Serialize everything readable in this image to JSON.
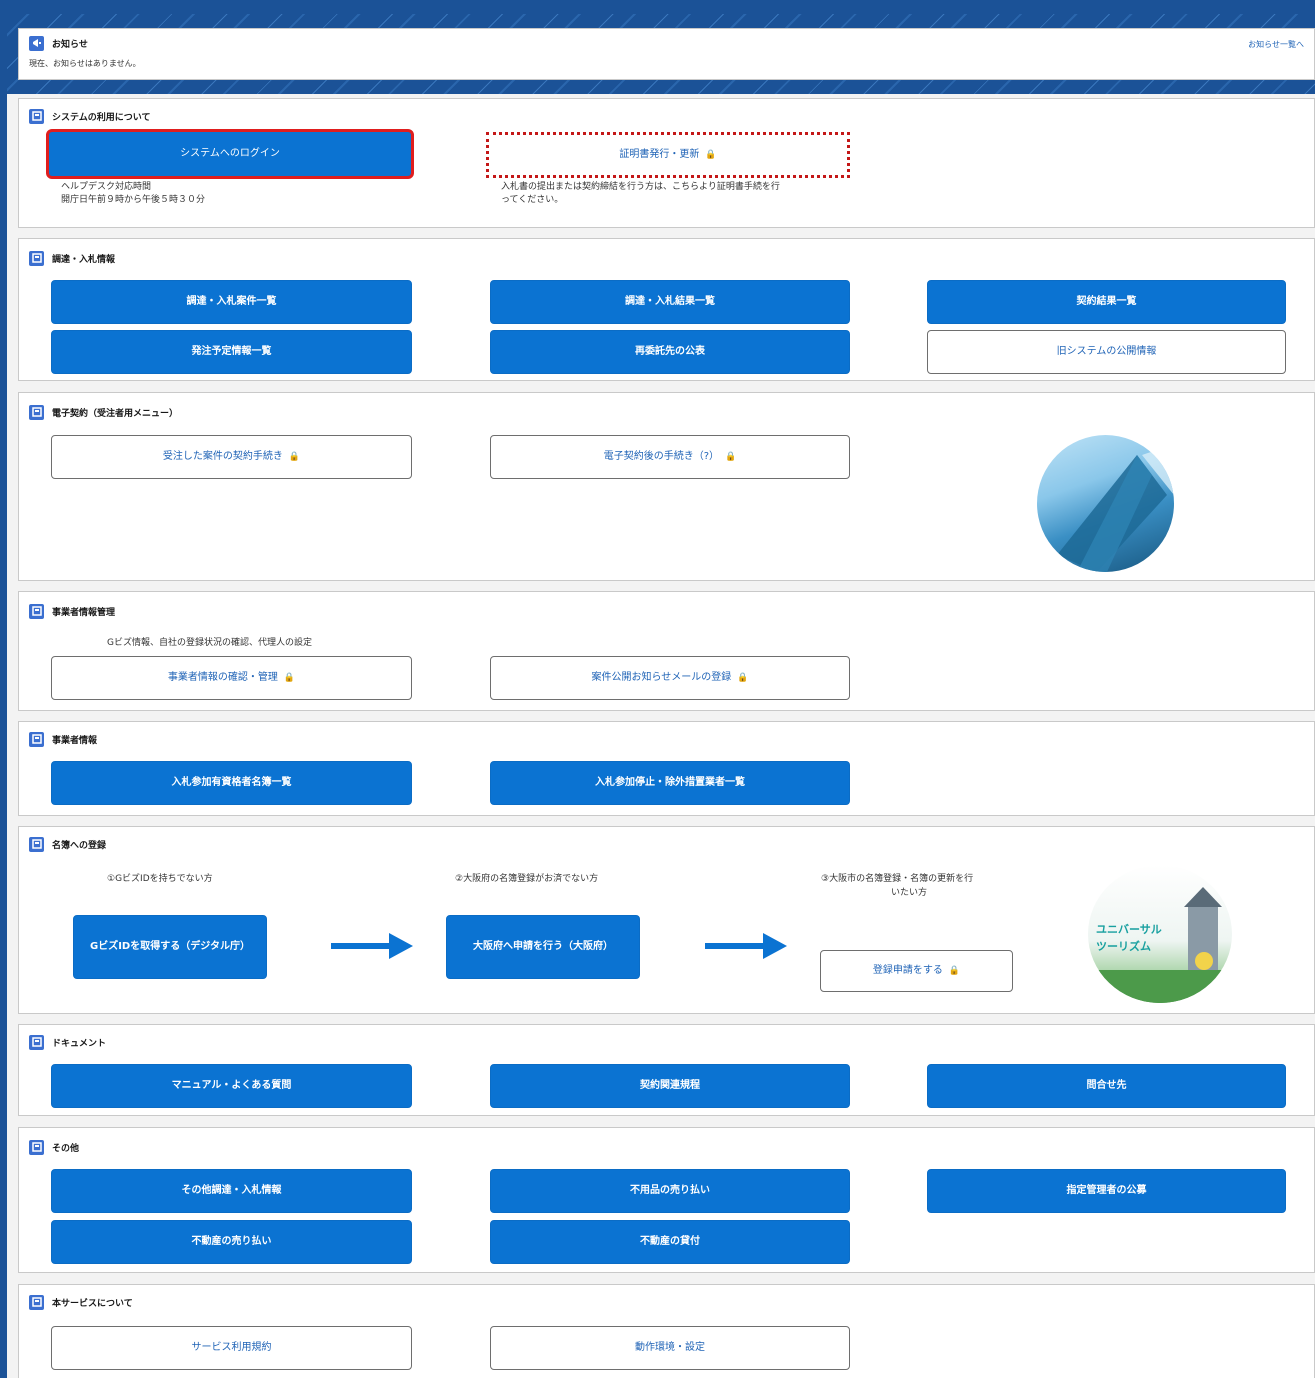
{
  "notice": {
    "title": "お知らせ",
    "message": "現在、お知らせはありません。",
    "list_link": "お知らせ一覧へ"
  },
  "system": {
    "title": "システムの利用について",
    "login_button": "システムへのログイン",
    "cert_button": "証明書発行・更新",
    "helpdesk_title": "ヘルプデスク対応時間",
    "helpdesk_hours": "開庁日午前９時から午後５時３０分",
    "cert_note_1": "入札書の提出または契約締結を行う方は、こちらより証明書手続を行",
    "cert_note_2": "ってください。"
  },
  "procurement": {
    "title": "調達・入札情報",
    "buttons": [
      "調達・入札案件一覧",
      "調達・入札結果一覧",
      "契約結果一覧",
      "発注予定情報一覧",
      "再委託先の公表",
      "旧システムの公開情報"
    ]
  },
  "econtract": {
    "title": "電子契約（受注者用メニュー）",
    "buttons": [
      "受注した案件の契約手続き",
      "電子契約後の手続き（?）"
    ]
  },
  "business_mgmt": {
    "title": "事業者情報管理",
    "description": "Gビズ情報、自社の登録状況の確認、代理人の設定",
    "buttons": [
      "事業者情報の確認・管理",
      "案件公開お知らせメールの登録"
    ]
  },
  "business_info": {
    "title": "事業者情報",
    "buttons": [
      "入札参加有資格者名簿一覧",
      "入札参加停止・除外措置業者一覧"
    ]
  },
  "registry": {
    "title": "名簿への登録",
    "step1_label": "①GビズIDを持ちでない方",
    "step1_button": "GビズIDを取得する（デジタル庁）",
    "step2_label": "②大阪府の名簿登録がお済でない方",
    "step2_button": "大阪府へ申請を行う（大阪府）",
    "step3_label_1": "③大阪市の名簿登録・名簿の更新を行",
    "step3_label_2": "いたい方",
    "step3_button": "登録申請をする",
    "promo_line1": "ユニバーサル",
    "promo_line2": "ツーリズム"
  },
  "documents": {
    "title": "ドキュメント",
    "buttons": [
      "マニュアル・よくある質問",
      "契約関連規程",
      "問合せ先"
    ]
  },
  "others": {
    "title": "その他",
    "buttons": [
      "その他調達・入札情報",
      "不用品の売り払い",
      "指定管理者の公募",
      "不動産の売り払い",
      "不動産の貸付"
    ]
  },
  "about": {
    "title": "本サービスについて",
    "buttons": [
      "サービス利用規約",
      "動作環境・設定"
    ]
  },
  "colors": {
    "primary_blue": "#0b73d2",
    "frame_navy": "#1b5297",
    "highlight_red": "#e01e1e"
  }
}
